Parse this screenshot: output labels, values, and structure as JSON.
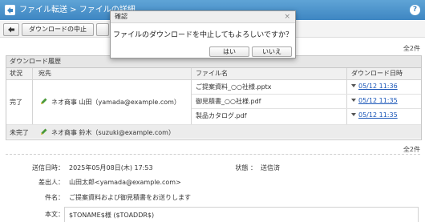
{
  "titlebar": {
    "breadcrumb": "ファイル転送 > ファイルの詳細",
    "help": "?"
  },
  "toolbar": {
    "stop_label": "ダウンロードの中止"
  },
  "total_top": "全2件",
  "total_bottom": "全2件",
  "history": {
    "title": "ダウンロード履歴",
    "columns": [
      "状況",
      "宛先",
      "ファイル名",
      "ダウンロード日時"
    ],
    "rows": [
      {
        "status": "完了",
        "recipient": "ネオ商事 山田（yamada@example.com）",
        "files": [
          {
            "name": "ご提案資料_○○社様.pptx",
            "date": "05/12 11:36"
          },
          {
            "name": "御見積書_○○社様.pdf",
            "date": "05/12 11:35"
          },
          {
            "name": "製品カタログ.pdf",
            "date": "05/12 11:35"
          }
        ]
      },
      {
        "status": "未完了",
        "recipient": "ネオ商事 鈴木（suzuki@example.com）"
      }
    ]
  },
  "details": {
    "sent_label": "送信日時：",
    "sent_value": "2025年05月08日(木) 17:53",
    "state_label": "状態 ：",
    "state_value": "送信済",
    "sender_label": "差出人：",
    "sender_value": "山田太郎<yamada@example.com>",
    "subject_label": "件名：",
    "subject_value": "ご提案資料および御見積書をお送りします",
    "body_label": "本文：",
    "body_value": "$TONAME$様 ($TOADDR$)"
  },
  "dialog": {
    "title": "確認",
    "close": "×",
    "message": "ファイルのダウンロードを中止してもよろしいですか？",
    "yes": "はい",
    "no": "いいえ"
  },
  "colors": {
    "titlebar": "#3e86c2",
    "link": "#1a56b8"
  }
}
